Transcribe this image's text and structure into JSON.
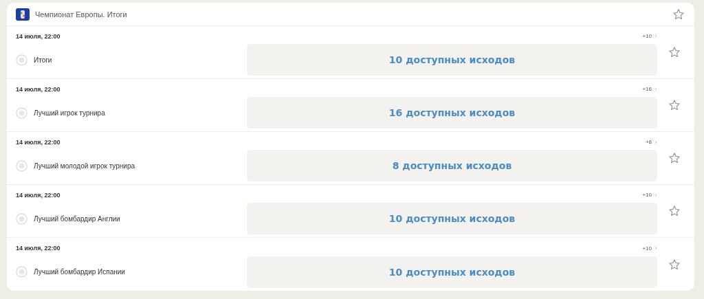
{
  "header": {
    "title": "Чемпионат Европы. Итоги"
  },
  "events": [
    {
      "date": "14 июля, 22:00",
      "more": "+10",
      "name": "Итоги",
      "outcomes": "10 доступных исходов"
    },
    {
      "date": "14 июля, 22:00",
      "more": "+16",
      "name": "Лучший игрок турнира",
      "outcomes": "16 доступных исходов"
    },
    {
      "date": "14 июля, 22:00",
      "more": "+8",
      "name": "Лучший молодой игрок турнира",
      "outcomes": "8 доступных исходов"
    },
    {
      "date": "14 июля, 22:00",
      "more": "+10",
      "name": "Лучший бомбардир Англии",
      "outcomes": "10 доступных исходов"
    },
    {
      "date": "14 июля, 22:00",
      "more": "+10",
      "name": "Лучший бомбардир Испании",
      "outcomes": "10 доступных исходов"
    }
  ]
}
